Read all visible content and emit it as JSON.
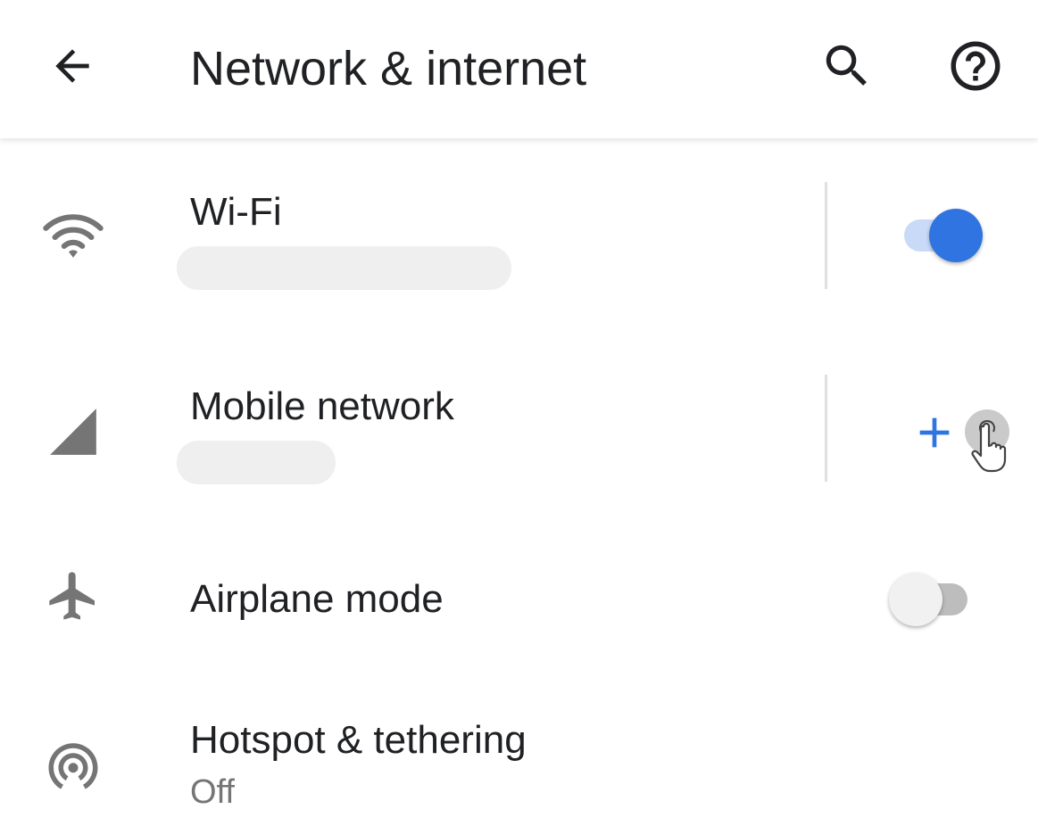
{
  "header": {
    "title": "Network & internet",
    "back_icon": "arrow-back-icon",
    "search_icon": "search-icon",
    "help_icon": "help-icon"
  },
  "items": [
    {
      "title": "Wi-Fi",
      "summary": "",
      "icon": "wifi-icon",
      "toggle_on": true
    },
    {
      "title": "Mobile network",
      "summary": "",
      "icon": "cellular-signal-icon",
      "action_icon": "add-icon"
    },
    {
      "title": "Airplane mode",
      "icon": "airplane-icon",
      "toggle_on": false
    },
    {
      "title": "Hotspot & tethering",
      "summary": "Off",
      "icon": "hotspot-icon"
    }
  ],
  "colors": {
    "accent": "#2f74e0",
    "accent_track": "#c8daf8",
    "icon_gray": "#757575",
    "text_primary": "#202124",
    "text_secondary": "#757575"
  }
}
